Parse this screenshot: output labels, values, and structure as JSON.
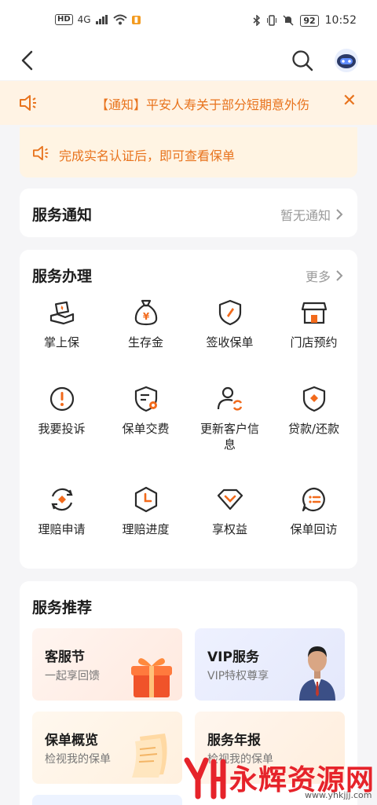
{
  "status_bar": {
    "hd": "HD",
    "net": "4G",
    "time": "10:52",
    "battery": "92"
  },
  "notice": {
    "text": "【通知】平安人寿关于部分短期意外伤"
  },
  "auth": {
    "text": "完成实名认证后，即可查看保单"
  },
  "service_notice": {
    "title": "服务通知",
    "status": "暂无通知"
  },
  "service_handling": {
    "title": "服务办理",
    "more": "更多",
    "items": [
      {
        "label": "掌上保",
        "icon": "palm-insurance-icon"
      },
      {
        "label": "生存金",
        "icon": "money-bag-icon"
      },
      {
        "label": "签收保单",
        "icon": "sign-policy-icon"
      },
      {
        "label": "门店预约",
        "icon": "store-icon"
      },
      {
        "label": "我要投诉",
        "icon": "complaint-icon"
      },
      {
        "label": "保单交费",
        "icon": "policy-payment-icon"
      },
      {
        "label": "更新客户信息",
        "icon": "update-customer-icon"
      },
      {
        "label": "贷款/还款",
        "icon": "loan-icon"
      },
      {
        "label": "理赔申请",
        "icon": "claim-apply-icon"
      },
      {
        "label": "理赔进度",
        "icon": "claim-progress-icon"
      },
      {
        "label": "享权益",
        "icon": "rights-icon"
      },
      {
        "label": "保单回访",
        "icon": "policy-revisit-icon"
      }
    ]
  },
  "recommend": {
    "title": "服务推荐",
    "tiles": [
      {
        "title": "客服节",
        "sub": "一起享回馈"
      },
      {
        "title": "VIP服务",
        "sub": "VIP特权尊享"
      },
      {
        "title": "保单概览",
        "sub": "检视我的保单"
      },
      {
        "title": "服务年报",
        "sub": "检视我的保单"
      }
    ]
  },
  "watermark": {
    "text": "永辉资源网",
    "url": "www.yhkjjj.com"
  },
  "colors": {
    "accent": "#e8731d",
    "icon_dark": "#2a2a2a",
    "icon_orange": "#f26a1b"
  }
}
